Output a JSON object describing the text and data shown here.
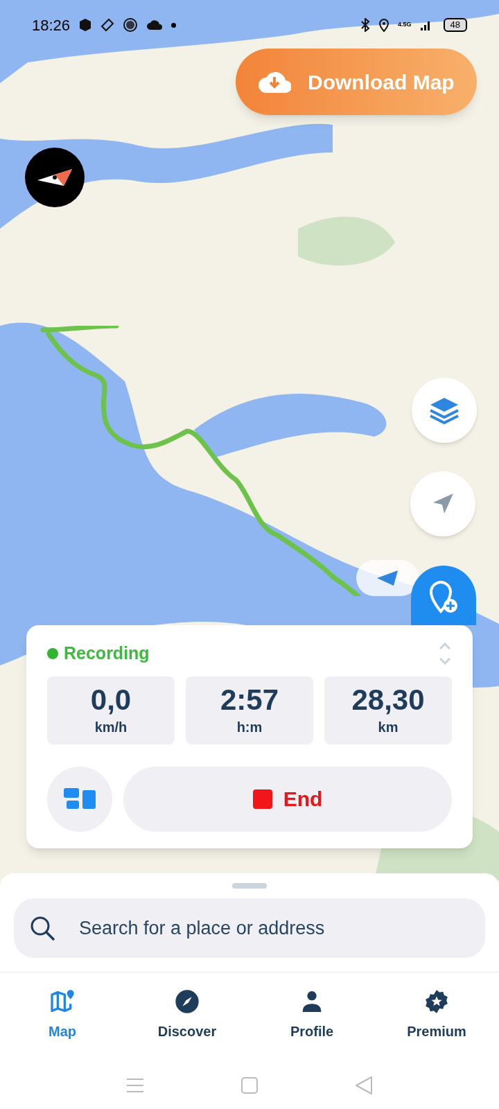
{
  "status_bar": {
    "time": "18:26",
    "network": "4.5G",
    "battery": "48"
  },
  "download_button": {
    "label": "Download Map"
  },
  "recording": {
    "status": "Recording",
    "stats": [
      {
        "value": "0,0",
        "unit": "km/h"
      },
      {
        "value": "2:57",
        "unit": "h:m"
      },
      {
        "value": "28,30",
        "unit": "km"
      }
    ],
    "end_button": "End"
  },
  "search": {
    "placeholder": "Search for a place or address"
  },
  "nav": [
    {
      "label": "Map",
      "kind": "map",
      "selected": true
    },
    {
      "label": "Discover",
      "kind": "discover",
      "selected": false
    },
    {
      "label": "Profile",
      "kind": "profile",
      "selected": false
    },
    {
      "label": "Premium",
      "kind": "premium",
      "selected": false
    }
  ]
}
